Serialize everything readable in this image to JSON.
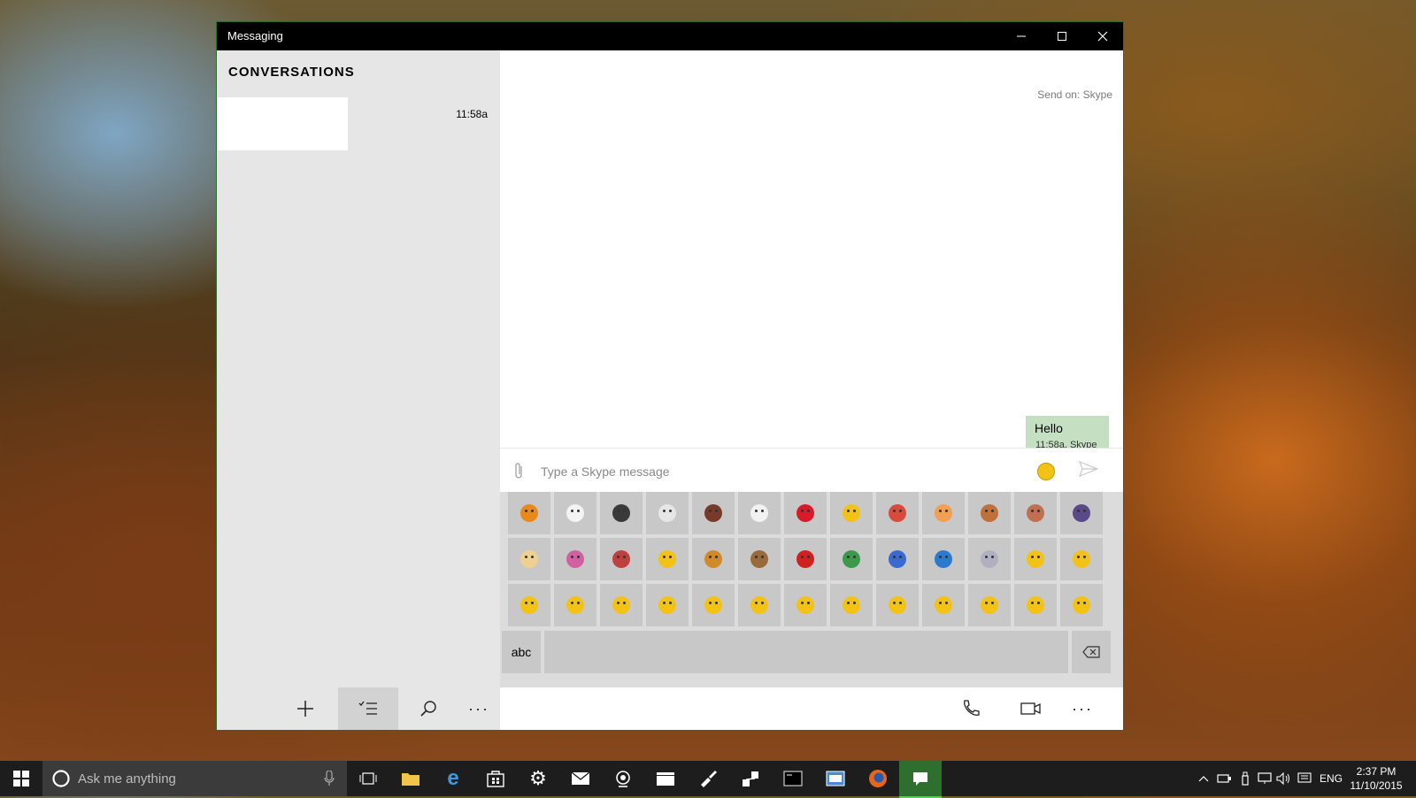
{
  "window": {
    "title": "Messaging"
  },
  "conversations": {
    "title": "CONVERSATIONS",
    "items": [
      {
        "time": "11:58a"
      }
    ]
  },
  "chat": {
    "send_on": "Send on: Skype",
    "messages": [
      {
        "text": "Hello",
        "meta": "11:58a, Skype"
      }
    ],
    "input_placeholder": "Type a Skype message"
  },
  "emoji_panel": {
    "abc_label": "abc",
    "emojis": [
      {
        "name": "pumpkin",
        "color": "#e8891a"
      },
      {
        "name": "ghost",
        "color": "#f4f4f4"
      },
      {
        "name": "dancer",
        "color": "#3a3a3a"
      },
      {
        "name": "vampire",
        "color": "#e6e6e6"
      },
      {
        "name": "girl",
        "color": "#7a3a2a"
      },
      {
        "name": "skull",
        "color": "#f2f2f2"
      },
      {
        "name": "lips",
        "color": "#d81b2a"
      },
      {
        "name": "laughing",
        "color": "#f2c316"
      },
      {
        "name": "figure-red-cap",
        "color": "#d84a3a"
      },
      {
        "name": "runner",
        "color": "#f0a050"
      },
      {
        "name": "person-standing",
        "color": "#c0703a"
      },
      {
        "name": "person-sitting",
        "color": "#c07050"
      },
      {
        "name": "person-arms-up",
        "color": "#5a4a8a"
      },
      {
        "name": "stretcher",
        "color": "#f0d090"
      },
      {
        "name": "person-pink",
        "color": "#d060a0"
      },
      {
        "name": "boxer",
        "color": "#c04040"
      },
      {
        "name": "party-face",
        "color": "#f2c316"
      },
      {
        "name": "cake",
        "color": "#d08a2a"
      },
      {
        "name": "monkey",
        "color": "#9a6a3a"
      },
      {
        "name": "devil",
        "color": "#d02020"
      },
      {
        "name": "zombie",
        "color": "#3a9a4a"
      },
      {
        "name": "penguin",
        "color": "#3a6ad0"
      },
      {
        "name": "blue-face",
        "color": "#2a7ad0"
      },
      {
        "name": "robot",
        "color": "#b0b0c0"
      },
      {
        "name": "smile",
        "color": "#f2c316"
      },
      {
        "name": "sad",
        "color": "#f2c316"
      },
      {
        "name": "grin",
        "color": "#f2c316"
      },
      {
        "name": "cool",
        "color": "#f2c316"
      },
      {
        "name": "surprised",
        "color": "#f2c316"
      },
      {
        "name": "wink",
        "color": "#f2c316"
      },
      {
        "name": "crying",
        "color": "#f2c316"
      },
      {
        "name": "sweat",
        "color": "#f2c316"
      },
      {
        "name": "speechless",
        "color": "#f2c316"
      },
      {
        "name": "kiss",
        "color": "#f2c316"
      },
      {
        "name": "tongue",
        "color": "#f2c316"
      },
      {
        "name": "blush",
        "color": "#f2c316"
      },
      {
        "name": "wondering",
        "color": "#f2c316"
      },
      {
        "name": "sleepy",
        "color": "#f2c316"
      },
      {
        "name": "dull",
        "color": "#f2c316"
      }
    ]
  },
  "taskbar": {
    "search_placeholder": "Ask me anything",
    "language": "ENG",
    "time": "2:37 PM",
    "date": "11/10/2015"
  },
  "colors": {
    "accent": "#1b8a1b",
    "bubble": "#c5dfc3",
    "sidebar": "#e6e6e6"
  }
}
